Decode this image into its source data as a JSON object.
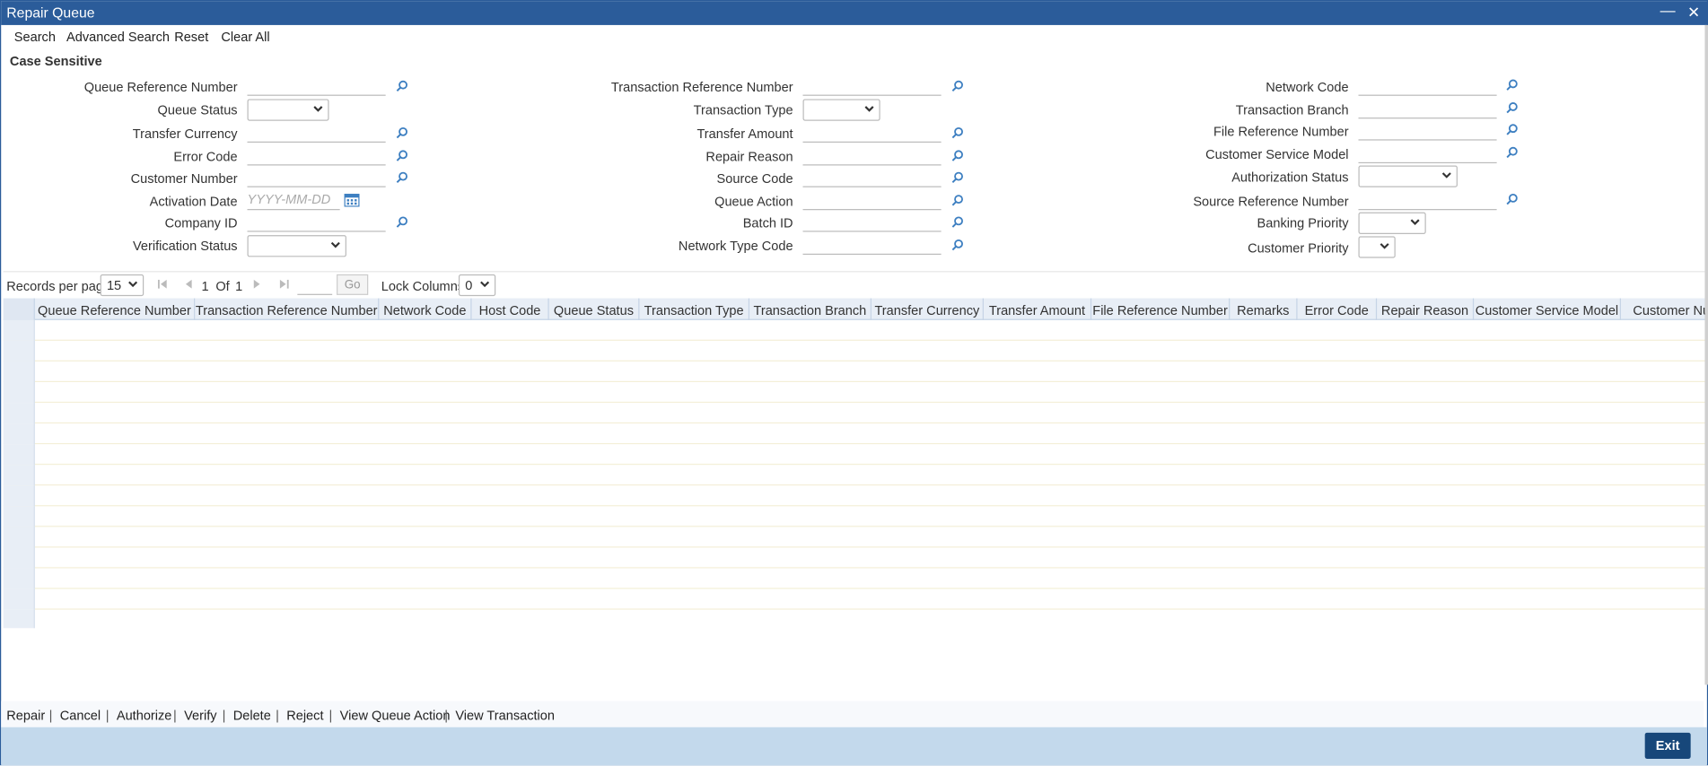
{
  "window": {
    "title": "Repair Queue",
    "minimize_icon": "minimize-icon",
    "close_icon": "close-icon"
  },
  "toolbar": {
    "search": "Search",
    "advanced_search": "Advanced Search",
    "reset": "Reset",
    "clear_all": "Clear All"
  },
  "search_panel": {
    "case_sensitive": "Case Sensitive",
    "col1": {
      "queue_reference_number": "Queue Reference Number",
      "queue_status": "Queue Status",
      "transfer_currency": "Transfer Currency",
      "error_code": "Error Code",
      "customer_number": "Customer Number",
      "activation_date": "Activation Date",
      "activation_date_placeholder": "YYYY-MM-DD",
      "company_id": "Company ID",
      "verification_status": "Verification Status"
    },
    "col2": {
      "transaction_reference_number": "Transaction Reference Number",
      "transaction_type": "Transaction Type",
      "transfer_amount": "Transfer Amount",
      "repair_reason": "Repair Reason",
      "source_code": "Source Code",
      "queue_action": "Queue Action",
      "batch_id": "Batch ID",
      "network_type_code": "Network Type Code"
    },
    "col3": {
      "network_code": "Network Code",
      "transaction_branch": "Transaction Branch",
      "file_reference_number": "File Reference Number",
      "customer_service_model": "Customer Service Model",
      "authorization_status": "Authorization Status",
      "source_reference_number": "Source Reference Number",
      "banking_priority": "Banking Priority",
      "customer_priority": "Customer Priority"
    }
  },
  "pager": {
    "records_per_page_label": "Records per page",
    "records_per_page_value": "15",
    "current_page": "1",
    "of_label": "Of",
    "total_pages": "1",
    "go_label": "Go",
    "lock_columns_label": "Lock Columns",
    "lock_columns_value": "0"
  },
  "grid": {
    "columns": [
      "Queue Reference Number",
      "Transaction Reference Number",
      "Network Code",
      "Host Code",
      "Queue Status",
      "Transaction Type",
      "Transaction Branch",
      "Transfer Currency",
      "Transfer Amount",
      "File Reference Number",
      "Remarks",
      "Error Code",
      "Repair Reason",
      "Customer Service Model",
      "Customer Nur"
    ],
    "empty_rows": 15
  },
  "actions": {
    "repair": "Repair",
    "cancel": "Cancel",
    "authorize": "Authorize",
    "verify": "Verify",
    "delete": "Delete",
    "reject": "Reject",
    "view_queue_action": "View Queue Action",
    "view_transaction": "View Transaction",
    "separator": "|"
  },
  "footer": {
    "exit": "Exit"
  },
  "colors": {
    "title_bar": "#2b5c9a",
    "footer": "#c3d9ec",
    "exit_button": "#17477a",
    "lookup_icon": "#3d7fc1"
  }
}
